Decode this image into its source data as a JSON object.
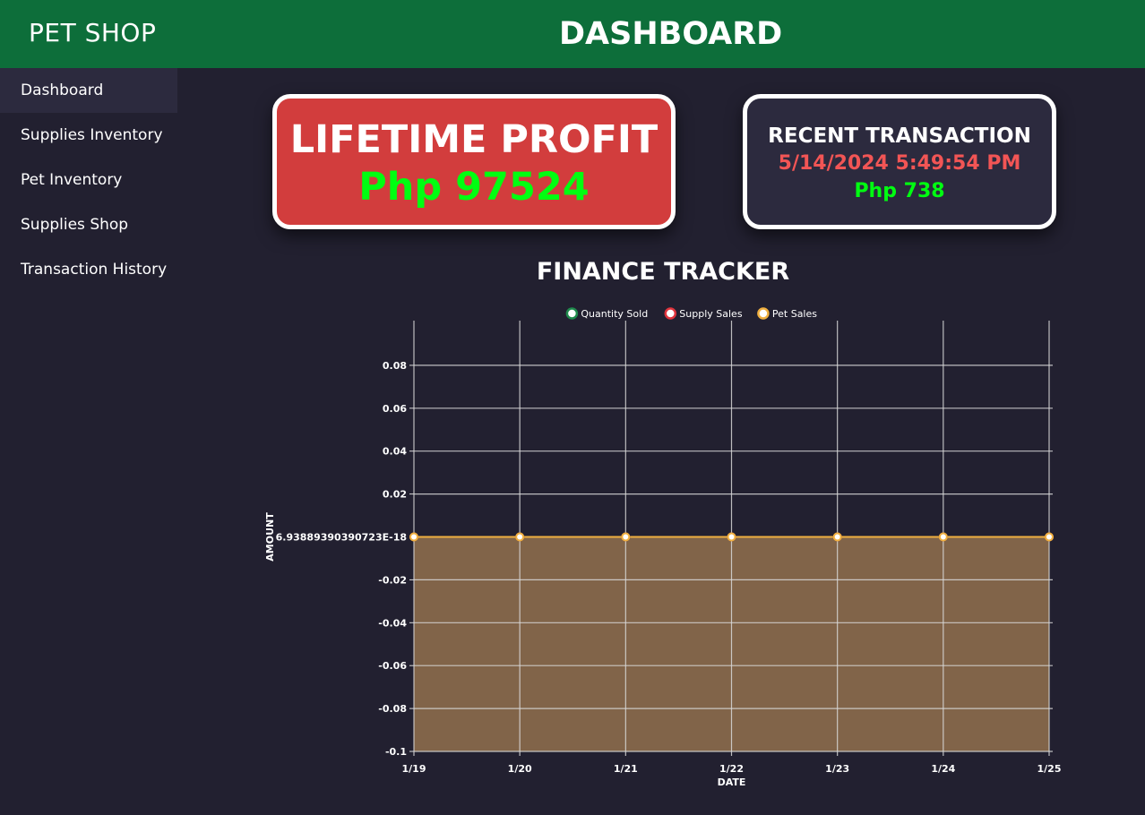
{
  "app": {
    "brand": "PET SHOP",
    "page_title": "DASHBOARD",
    "header_color": "#0d6e3a"
  },
  "sidebar": {
    "items": [
      {
        "label": "Dashboard",
        "active": true
      },
      {
        "label": "Supplies Inventory",
        "active": false
      },
      {
        "label": "Pet Inventory",
        "active": false
      },
      {
        "label": "Supplies Shop",
        "active": false
      },
      {
        "label": "Transaction History",
        "active": false
      }
    ]
  },
  "profit_card": {
    "label": "LIFETIME PROFIT",
    "value": "Php 97524"
  },
  "recent_card": {
    "label": "RECENT TRANSACTION",
    "timestamp": "5/14/2024 5:49:54 PM",
    "amount": "Php 738"
  },
  "chart_title": "FINANCE TRACKER",
  "chart_data": {
    "type": "line",
    "title": "FINANCE TRACKER",
    "xlabel": "DATE",
    "ylabel": "AMOUNT",
    "categories": [
      "1/19",
      "1/20",
      "1/21",
      "1/22",
      "1/23",
      "1/24",
      "1/25"
    ],
    "ylim": [
      -0.1,
      0.1
    ],
    "yticks": [
      {
        "value": 0.08,
        "label": "0.08"
      },
      {
        "value": 0.06,
        "label": "0.06"
      },
      {
        "value": 0.04,
        "label": "0.04"
      },
      {
        "value": 0.02,
        "label": "0.02"
      },
      {
        "value": 0,
        "label": "6.93889390390723E-18"
      },
      {
        "value": -0.02,
        "label": "-0.02"
      },
      {
        "value": -0.04,
        "label": "-0.04"
      },
      {
        "value": -0.06,
        "label": "-0.06"
      },
      {
        "value": -0.08,
        "label": "-0.08"
      },
      {
        "value": -0.1,
        "label": "-0.1"
      }
    ],
    "grid": true,
    "legend_position": "top",
    "series": [
      {
        "name": "Quantity Sold",
        "color": "#1f8a4c",
        "values": [
          0,
          0,
          0,
          0,
          0,
          0,
          0
        ],
        "fill": false
      },
      {
        "name": "Supply Sales",
        "color": "#e0343d",
        "values": [
          0,
          0,
          0,
          0,
          0,
          0,
          0
        ],
        "fill": false
      },
      {
        "name": "Pet Sales",
        "color": "#f0b040",
        "values": [
          0,
          0,
          0,
          0,
          0,
          0,
          0
        ],
        "fill": true,
        "fill_color": "#816449"
      }
    ]
  }
}
